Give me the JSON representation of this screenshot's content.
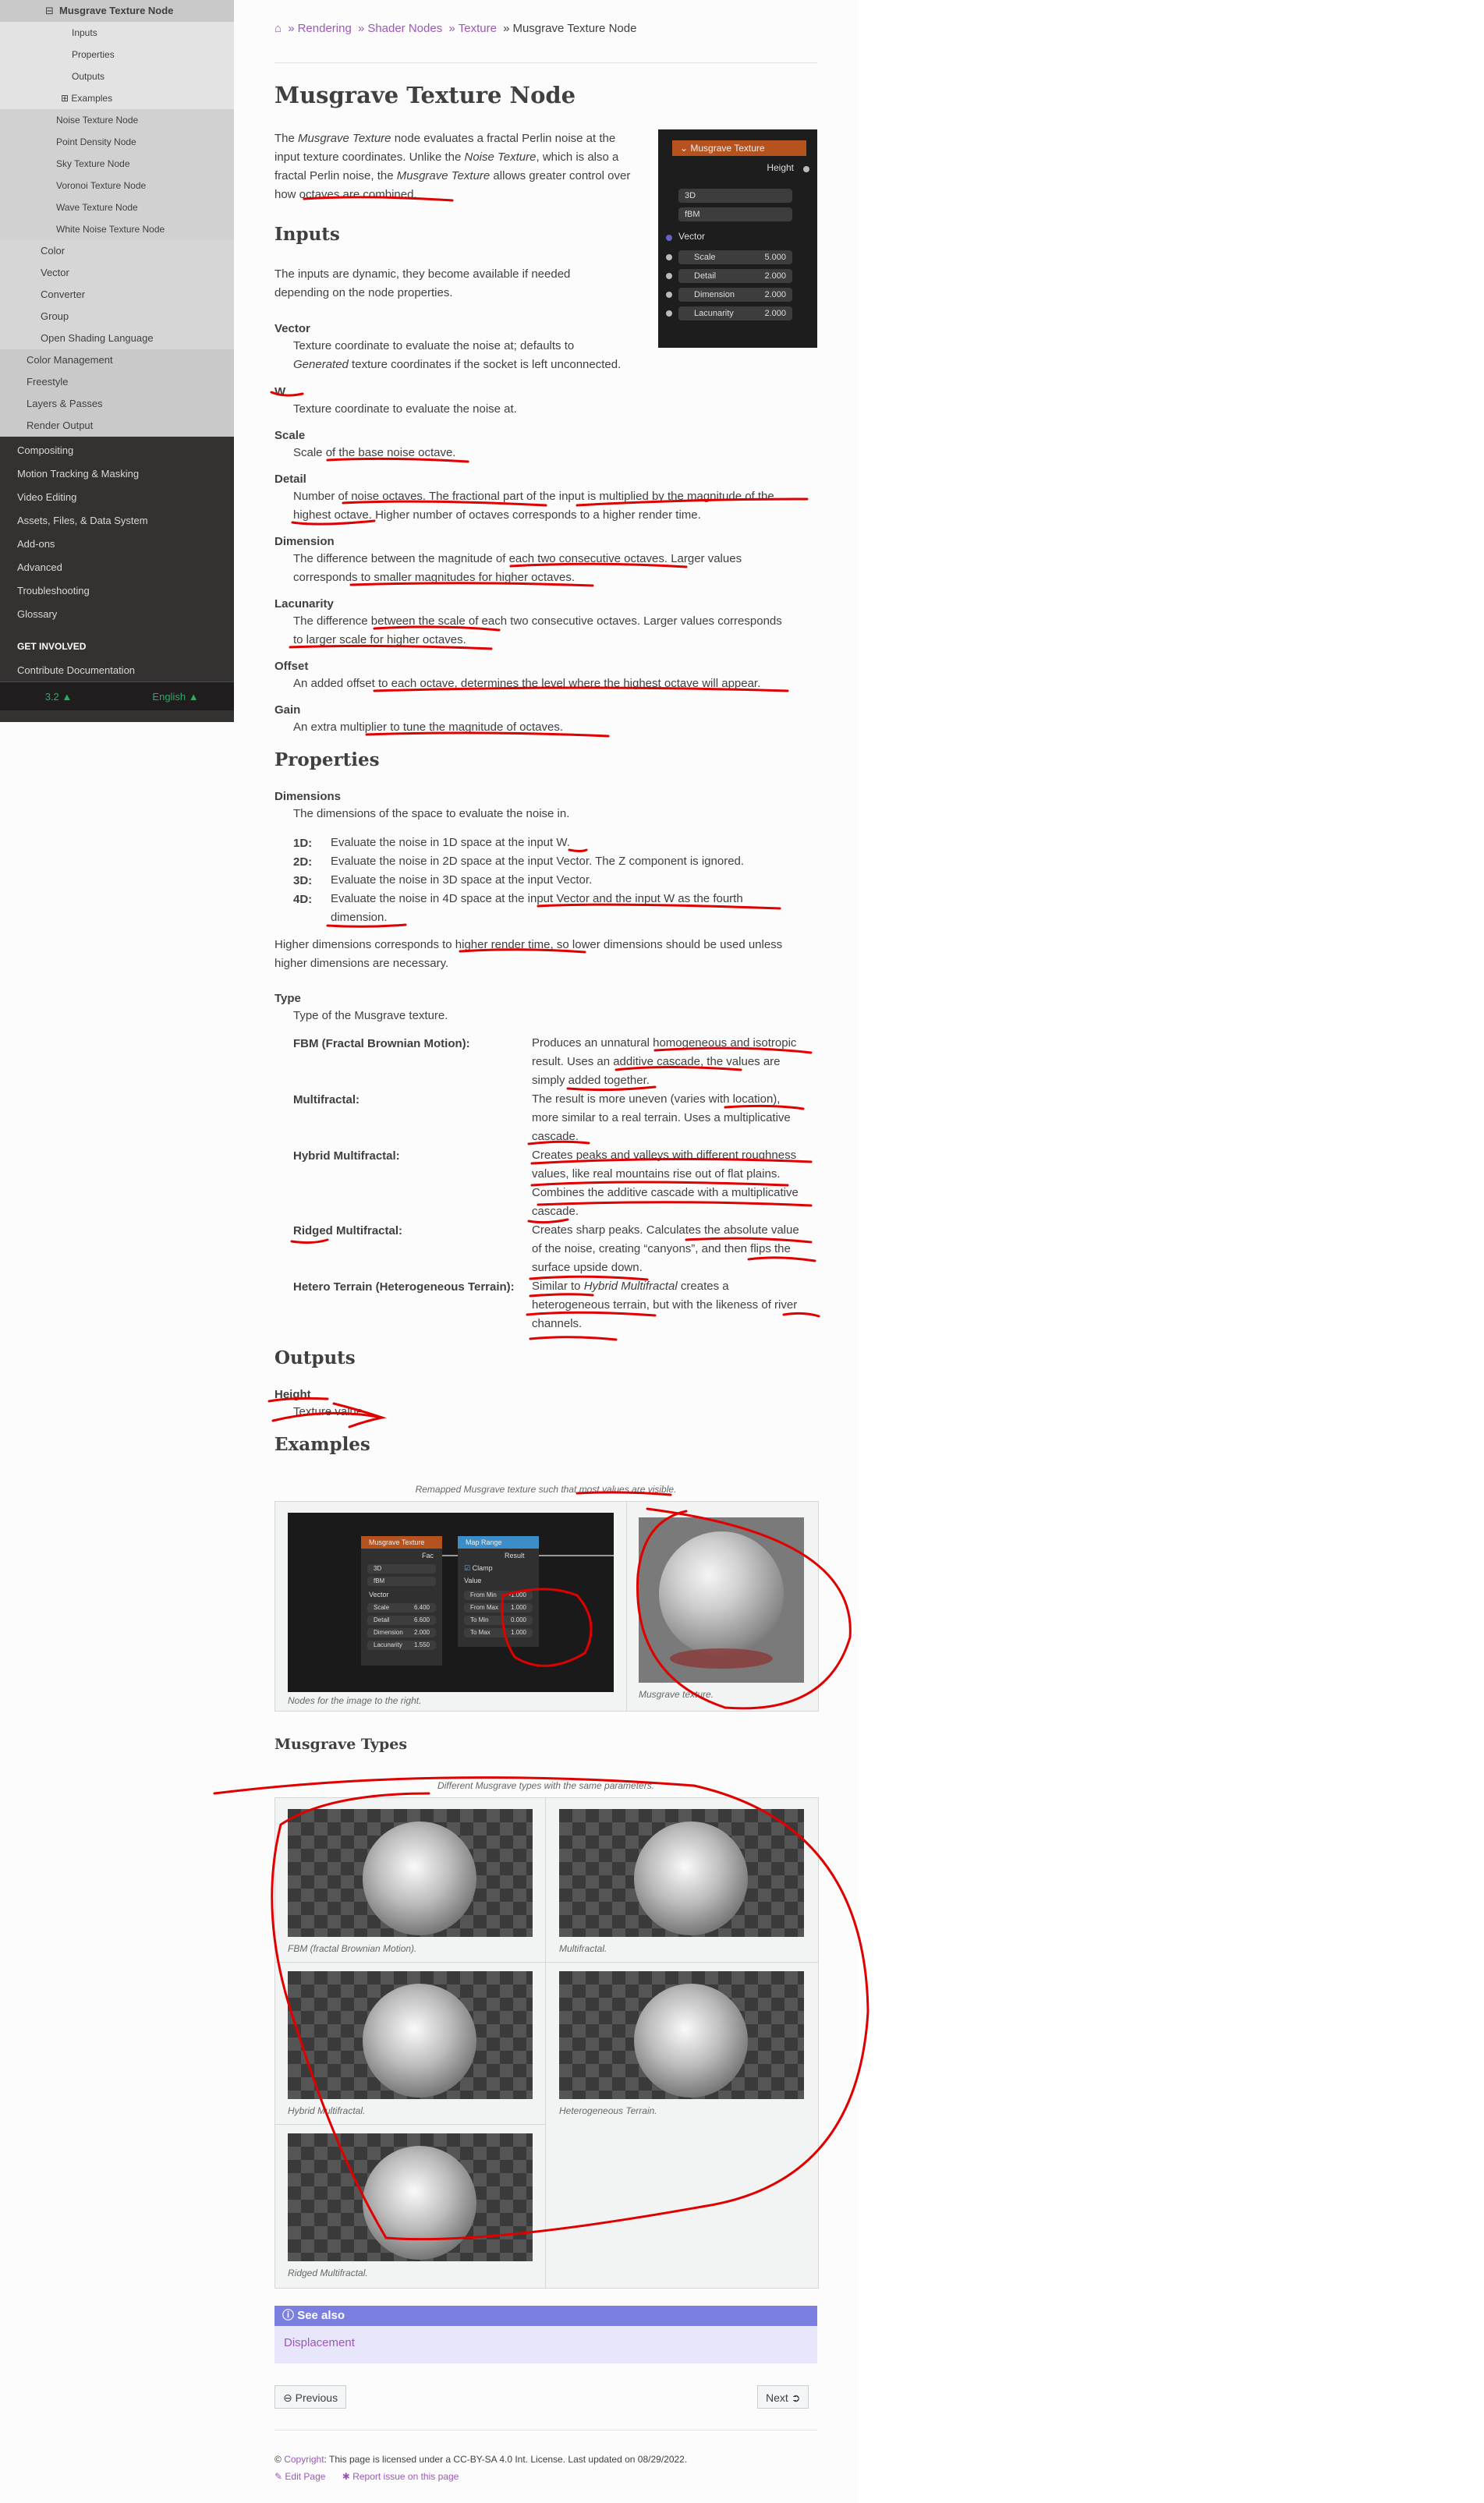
{
  "sidebar": {
    "current": "Musgrave Texture Node",
    "sub": [
      "Inputs",
      "Properties",
      "Outputs",
      "Examples"
    ],
    "siblings": [
      "Noise Texture Node",
      "Point Density Node",
      "Sky Texture Node",
      "Voronoi Texture Node",
      "Wave Texture Node",
      "White Noise Texture Node"
    ],
    "categories": [
      "Color",
      "Vector",
      "Converter",
      "Group",
      "Open Shading Language"
    ],
    "rendering_items": [
      "Color Management",
      "Freestyle",
      "Layers & Passes",
      "Render Output"
    ],
    "top_items": [
      "Compositing",
      "Motion Tracking & Masking",
      "Video Editing",
      "Assets, Files, & Data System",
      "Add-ons",
      "Advanced",
      "Troubleshooting",
      "Glossary"
    ],
    "caption": "GET INVOLVED",
    "contribute": "Contribute Documentation",
    "version": "3.2",
    "language": "English"
  },
  "breadcrumbs": [
    "Rendering",
    "Shader Nodes",
    "Texture",
    "Musgrave Texture Node"
  ],
  "title": "Musgrave Texture Node",
  "intro": {
    "a": "The ",
    "b": "Musgrave Texture",
    "c": " node evaluates a fractal Perlin noise at the input texture coordinates. Unlike the ",
    "d": "Noise Texture",
    "e": ", which is also a fractal Perlin noise, the ",
    "f": "Musgrave Texture",
    "g": " allows greater control over how octaves are combined."
  },
  "node_image": {
    "header": "Musgrave Texture",
    "output": "Height",
    "dim": "3D",
    "type": "fBM",
    "vector": "Vector",
    "fields": [
      {
        "label": "Scale",
        "value": "5.000"
      },
      {
        "label": "Detail",
        "value": "2.000"
      },
      {
        "label": "Dimension",
        "value": "2.000"
      },
      {
        "label": "Lacunarity",
        "value": "2.000"
      }
    ]
  },
  "inputs": {
    "heading": "Inputs",
    "intro": "The inputs are dynamic, they become available if needed depending on the node properties.",
    "vector_term": "Vector",
    "vector_def_1": "Texture coordinate to evaluate the noise at; defaults to",
    "vector_def_2a": "Generated",
    "vector_def_2b": " texture coordinates if the socket is left unconnected.",
    "w_term": "W",
    "w_def": "Texture coordinate to evaluate the noise at.",
    "scale_term": "Scale",
    "scale_def": "Scale of the base noise octave.",
    "detail_term": "Detail",
    "detail_def_1": "Number of noise octaves. The fractional part of the input is multiplied by the magnitude of the",
    "detail_def_2": "highest octave. Higher number of octaves corresponds to a higher render time.",
    "dimension_term": "Dimension",
    "dimension_def_1": "The difference between the magnitude of each two consecutive octaves. Larger values",
    "dimension_def_2": "corresponds to smaller magnitudes for higher octaves.",
    "lacunarity_term": "Lacunarity",
    "lacunarity_def_1": "The difference between the scale of each two consecutive octaves. Larger values corresponds",
    "lacunarity_def_2": "to larger scale for higher octaves.",
    "offset_term": "Offset",
    "offset_def": "An added offset to each octave, determines the level where the highest octave will appear.",
    "gain_term": "Gain",
    "gain_def": "An extra multiplier to tune the magnitude of octaves."
  },
  "properties": {
    "heading": "Properties",
    "dims_term": "Dimensions",
    "dims_def": "The dimensions of the space to evaluate the noise in.",
    "d1": "1D:",
    "d1_text": "Evaluate the noise in 1D space at the input W.",
    "d2": "2D:",
    "d2_text": "Evaluate the noise in 2D space at the input Vector. The Z component is ignored.",
    "d3": "3D:",
    "d3_text": "Evaluate the noise in 3D space at the input Vector.",
    "d4": "4D:",
    "d4_text_1": "Evaluate the noise in 4D space at the input Vector and the input W as the fourth",
    "d4_text_2": "dimension.",
    "higher_1": "Higher dimensions corresponds to higher render time, so lower dimensions should be used unless",
    "higher_2": "higher dimensions are necessary.",
    "type_term": "Type",
    "type_def": "Type of the Musgrave texture.",
    "fbm": "FBM (Fractal Brownian Motion):",
    "fbm_1": "Produces an unnatural homogeneous and isotropic",
    "fbm_2": "result. Uses an additive cascade, the values are",
    "fbm_3": "simply added together.",
    "multi": "Multifractal:",
    "multi_1": "The result is more uneven (varies with location),",
    "multi_2": "more similar to a real terrain. Uses a multiplicative",
    "multi_3": "cascade.",
    "hybrid": "Hybrid Multifractal:",
    "hybrid_1": "Creates peaks and valleys with different roughness",
    "hybrid_2": "values, like real mountains rise out of flat plains.",
    "hybrid_3": "Combines the additive cascade with a multiplicative",
    "hybrid_4": "cascade.",
    "ridged": "Ridged Multifractal:",
    "ridged_1": "Creates sharp peaks. Calculates the absolute value",
    "ridged_2": "of the noise, creating “canyons”, and then flips the",
    "ridged_3": "surface upside down.",
    "hetero": "Hetero Terrain (Heterogeneous Terrain):",
    "hetero_1a": "Similar to ",
    "hetero_1b": "Hybrid Multifractal",
    "hetero_1c": " creates a",
    "hetero_2": "heterogeneous terrain, but with the likeness of river",
    "hetero_3": "channels."
  },
  "outputs": {
    "heading": "Outputs",
    "term": "Height",
    "def": "Texture value."
  },
  "examples": {
    "heading": "Examples",
    "caption": "Remapped Musgrave texture such that most values are visible.",
    "left_caption": "Nodes for the image to the right.",
    "right_caption": "Musgrave texture.",
    "node1_header": "Musgrave Texture",
    "node1_out": "Fac",
    "node1_dim": "3D",
    "node1_type": "fBM",
    "node1_vector": "Vector",
    "node1_fields": [
      {
        "label": "Scale",
        "value": "6.400"
      },
      {
        "label": "Detail",
        "value": "6.600"
      },
      {
        "label": "Dimension",
        "value": "2.000"
      },
      {
        "label": "Lacunarity",
        "value": "1.550"
      }
    ],
    "node2_header": "Map Range",
    "node2_out": "Result",
    "node2_clamp": "Clamp",
    "node2_value": "Value",
    "node2_fields": [
      {
        "label": "From Min",
        "value": "-1.000"
      },
      {
        "label": "From Max",
        "value": "1.000"
      },
      {
        "label": "To Min",
        "value": "0.000"
      },
      {
        "label": "To Max",
        "value": "1.000"
      }
    ]
  },
  "types": {
    "heading": "Musgrave Types",
    "caption": "Different Musgrave types with the same parameters.",
    "c1": "FBM (fractal Brownian Motion).",
    "c2": "Multifractal.",
    "c3": "Hybrid Multifractal.",
    "c4": "Heterogeneous Terrain.",
    "c5": "Ridged Multifractal."
  },
  "see_also": {
    "title": "See also",
    "link": "Displacement"
  },
  "nav": {
    "prev": "Previous",
    "next": "Next"
  },
  "footer": {
    "copy_a": "© ",
    "copy_link": "Copyright",
    "copy_b": ": This page is licensed under a CC-BY-SA 4.0 Int. License. Last updated on 08/29/2022.",
    "edit": "Edit Page",
    "report": "Report issue on this page"
  },
  "colors": {
    "link": "#9b59b6",
    "sidebar_dark": "#343131",
    "annotation": "#e00000",
    "node_header_musgrave": "#b6521e",
    "node_header_map_range": "#3c8ec9",
    "see_also": "#7b7fe0"
  }
}
